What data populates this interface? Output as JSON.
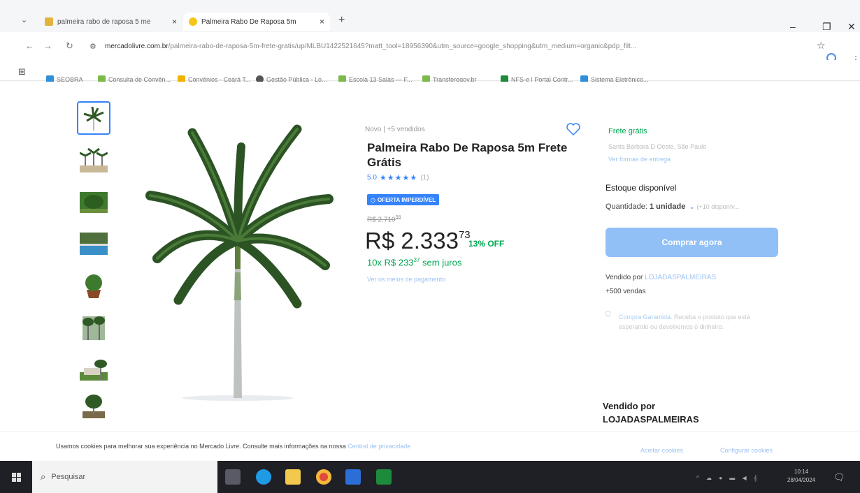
{
  "browser": {
    "tabs": [
      {
        "title": "palmeira rabo de raposa 5 me",
        "close": "×",
        "fav_color": "#e2b33c"
      },
      {
        "title": "Palmeira Rabo De Raposa 5m",
        "close": "×",
        "fav_color": "#f5c518"
      }
    ],
    "new_tab": "+",
    "window": {
      "minimize": "–",
      "restore": "❐",
      "close": "✕"
    },
    "url_domain": "mercadolivre.com.br",
    "url_path": "/palmeira-rabo-de-raposa-5m-frete-gratis/up/MLBU1422521645?matt_tool=18956390&utm_source=google_shopping&utm_medium=organic&pdp_filt...",
    "bookmarks": [
      {
        "label": "SEOBRA",
        "color": "#2f8fd8"
      },
      {
        "label": "Consulta de Convên...",
        "color": "#7dba4c"
      },
      {
        "label": "Convênios - Ceará T...",
        "color": "#f0b400"
      },
      {
        "label": "Gestão Pública - Lo...",
        "color": "#555"
      },
      {
        "label": "Escola 13 Salas — F...",
        "color": "#7dba4c"
      },
      {
        "label": "Transferegov.br",
        "color": "#7dba4c"
      },
      {
        "label": "NFS-e | Portal Contr...",
        "color": "#1e8a3c"
      },
      {
        "label": "Sistema Eletrônico...",
        "color": "#2f8fd8"
      }
    ]
  },
  "product": {
    "condition": "Novo | +5 vendidos",
    "title": "Palmeira Rabo De Raposa 5m Frete Grátis",
    "rating_value": "5.0",
    "stars": "★★★★★",
    "rating_count": "(1)",
    "badge": "OFERTA IMPERDÍVEL",
    "old_price": "R$ 2.710",
    "old_price_cents": "58",
    "price_main": "R$ 2.333",
    "price_cents": "73",
    "discount": "13% OFF",
    "installments": "10x R$ 233",
    "installments_cents": "37",
    "installments_suffix": " sem juros",
    "payment_link": "Ver os meios de pagamento"
  },
  "shipping": {
    "free": "Frete grátis",
    "from": "Santa Bárbara D Oeste, São Paulo",
    "link": "Ver formas de entrega"
  },
  "stock": {
    "title": "Estoque disponível",
    "qty_label": "Quantidade: ",
    "qty_value": "1 unidade",
    "available": "(+10 disponív..."
  },
  "buy_button": "Comprar agora",
  "seller": {
    "sold_by": "Vendido por ",
    "store": "LOJADASPALMEIRAS",
    "sales": "+500 vendas",
    "guarantee_link": "Compra Garantida.",
    "guarantee_text": " Receba o produto que está esperando ou devolvemos o dinheiro.",
    "section_title": "Vendido por",
    "section_store": "LOJADASPALMEIRAS"
  },
  "cookies": {
    "text": "Usamos cookies para melhorar sua experiência no Mercado Livre. Consulte mais informações na nossa ",
    "link": "Central de privacidade",
    "accept": "Aceitar cookies",
    "configure": "Configurar cookies"
  },
  "taskbar": {
    "search": "Pesquisar",
    "time": "10:14",
    "date": "28/04/2024"
  },
  "colors": {
    "brand_blue": "#3483fa",
    "green": "#00a650"
  }
}
